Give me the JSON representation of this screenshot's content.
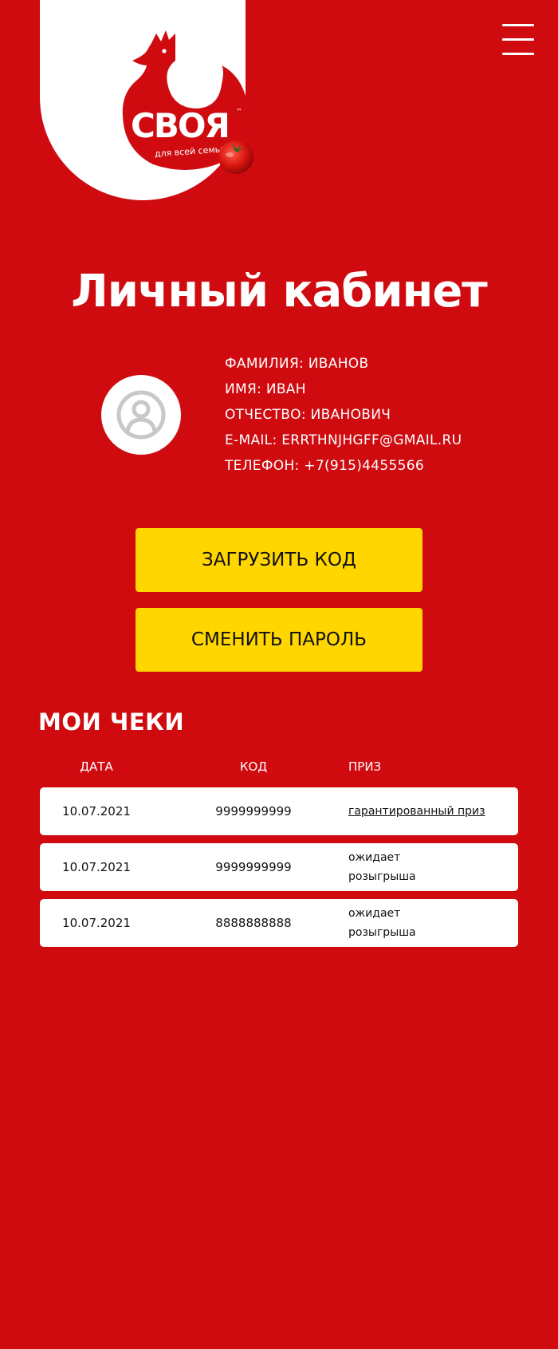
{
  "brand": {
    "name": "СВОЯ",
    "trademark": "™",
    "tagline": "для всей семьи"
  },
  "colors": {
    "background": "#cf0b10",
    "button": "#ffd600",
    "card": "#ffffff",
    "text_light": "#ffffff",
    "text_dark": "#111111"
  },
  "header": {
    "menu_icon": "hamburger-menu-icon"
  },
  "page": {
    "title": "Личный кабинет"
  },
  "profile": {
    "avatar_icon": "user-avatar-icon",
    "lines": [
      "Фамилия: Иванов",
      "Имя: Иван",
      "Отчество: Иванович",
      "E-mail: errthnjhgff@gmail.ru",
      "Телефон: +7(915)4455566"
    ]
  },
  "actions": {
    "upload_code": "Загрузить код",
    "change_password": "Сменить пароль"
  },
  "receipts": {
    "title": "Мои чеки",
    "columns": {
      "date": "Дата",
      "code": "Код",
      "prize": "Приз"
    },
    "rows": [
      {
        "date": "10.07.2021",
        "code": "9999999999",
        "prize": "гарантированный приз"
      },
      {
        "date": "10.07.2021",
        "code": "9999999999",
        "prize": "ожидает розыгрыша"
      },
      {
        "date": "10.07.2021",
        "code": "8888888888",
        "prize": "ожидает розыгрыша"
      }
    ]
  }
}
